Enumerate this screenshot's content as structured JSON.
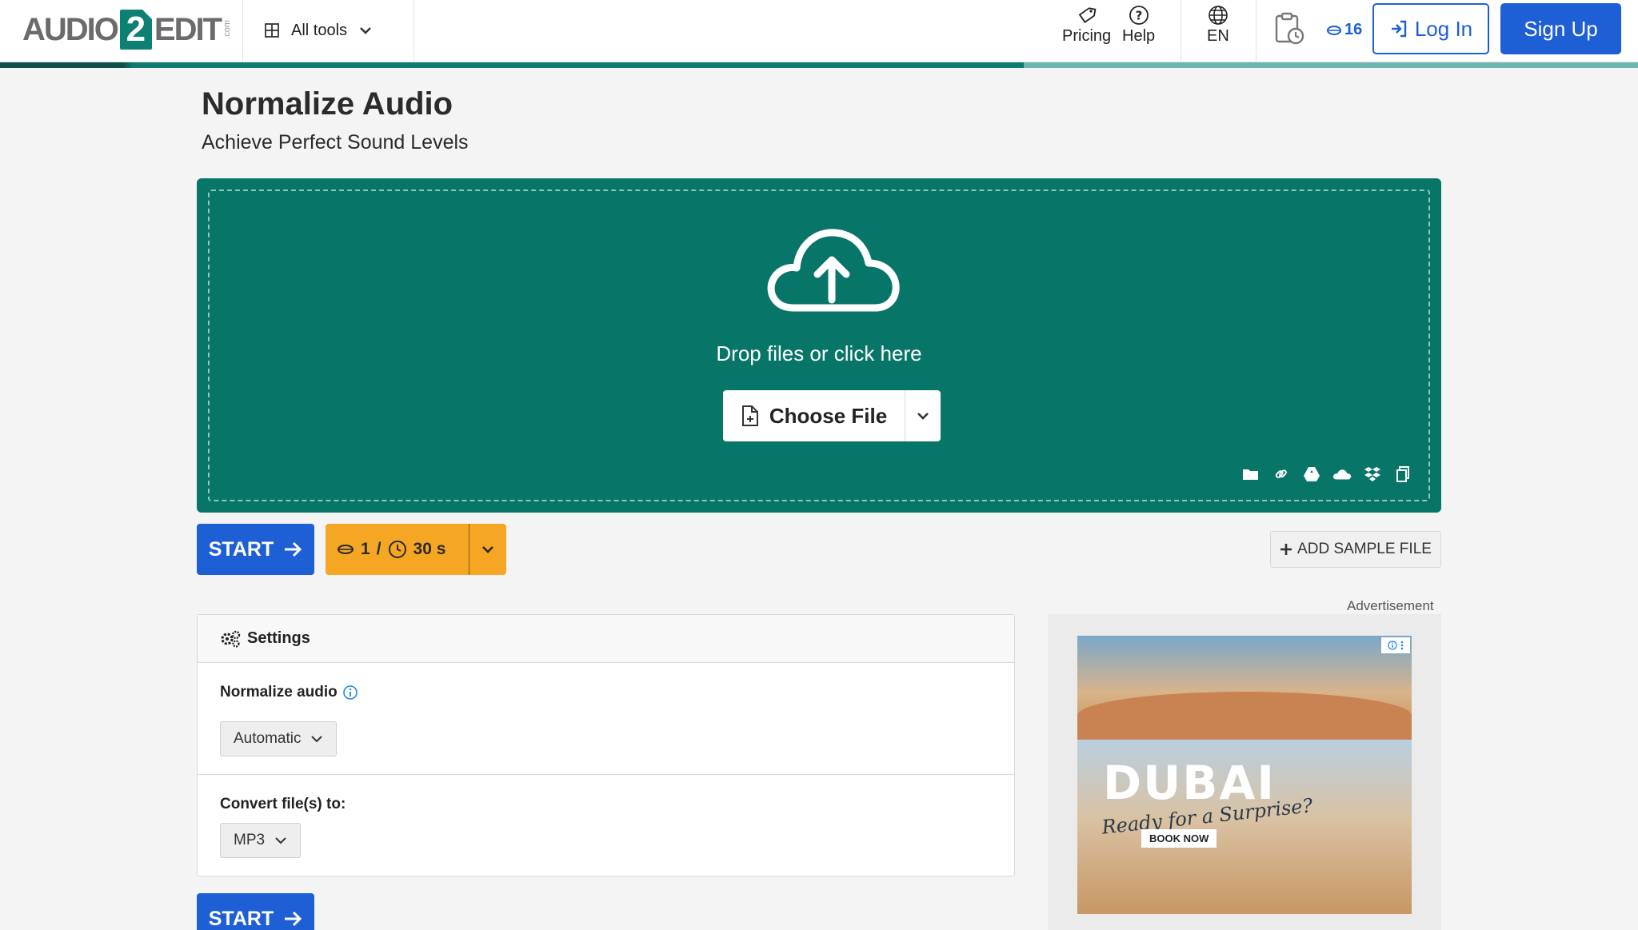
{
  "header": {
    "logo": {
      "part1": "AUDIO",
      "part2": "2",
      "part3": "EDIT",
      "suffix": ".com"
    },
    "all_tools": "All tools",
    "pricing": "Pricing",
    "help": "Help",
    "language": "EN",
    "credits": "16",
    "login": "Log In",
    "signup": "Sign Up"
  },
  "page": {
    "title": "Normalize Audio",
    "subtitle": "Achieve Perfect Sound Levels"
  },
  "dropzone": {
    "text": "Drop files or click here",
    "choose_file": "Choose File"
  },
  "actions": {
    "start": "START",
    "cost_credits": "1",
    "cost_sep": "/",
    "cost_time": "30 s",
    "add_sample": "ADD SAMPLE FILE"
  },
  "settings": {
    "heading": "Settings",
    "normalize_label": "Normalize audio",
    "normalize_value": "Automatic",
    "convert_label": "Convert file(s) to:",
    "convert_value": "MP3"
  },
  "ad": {
    "label": "Advertisement",
    "title": "DUBAI",
    "tagline": "Ready for a Surprise?",
    "cta": "BOOK NOW"
  },
  "colors": {
    "brand_teal": "#087569",
    "primary_blue": "#1e5fd6",
    "cost_orange": "#f5a623"
  }
}
